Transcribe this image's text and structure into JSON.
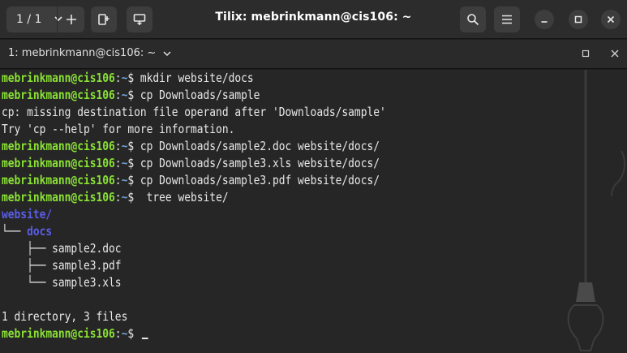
{
  "titlebar": {
    "session_label": "1 / 1",
    "title": "Tilix: mebrinkmann@cis106: ~"
  },
  "terminal_header": {
    "tab_label": "1: mebrinkmann@cis106: ~"
  },
  "terminal": {
    "prompt_user": "mebrinkmann@cis106",
    "prompt_sep": ":",
    "prompt_path": "~",
    "prompt_dollar": "$",
    "lines": [
      {
        "kind": "prompt",
        "cmd": " mkdir website/docs"
      },
      {
        "kind": "prompt",
        "cmd": " cp Downloads/sample"
      },
      {
        "kind": "text",
        "text": "cp: missing destination file operand after 'Downloads/sample'"
      },
      {
        "kind": "text",
        "text": "Try 'cp --help' for more information."
      },
      {
        "kind": "prompt",
        "cmd": " cp Downloads/sample2.doc website/docs/"
      },
      {
        "kind": "prompt",
        "cmd": " cp Downloads/sample3.xls website/docs/"
      },
      {
        "kind": "prompt",
        "cmd": " cp Downloads/sample3.pdf website/docs/"
      },
      {
        "kind": "prompt",
        "cmd": "  tree website/"
      },
      {
        "kind": "dir",
        "prefix": "",
        "name": "website/"
      },
      {
        "kind": "dir",
        "prefix": "└── ",
        "name": "docs"
      },
      {
        "kind": "text",
        "text": "    ├── sample2.doc"
      },
      {
        "kind": "text",
        "text": "    ├── sample3.pdf"
      },
      {
        "kind": "text",
        "text": "    └── sample3.xls"
      },
      {
        "kind": "text",
        "text": ""
      },
      {
        "kind": "text",
        "text": "1 directory, 3 files"
      },
      {
        "kind": "prompt",
        "cmd": " ",
        "cursor": true
      }
    ]
  },
  "colors": {
    "user": "#8ae234",
    "path": "#729fcf",
    "directory": "#5a5ee8",
    "background": "#262626"
  }
}
